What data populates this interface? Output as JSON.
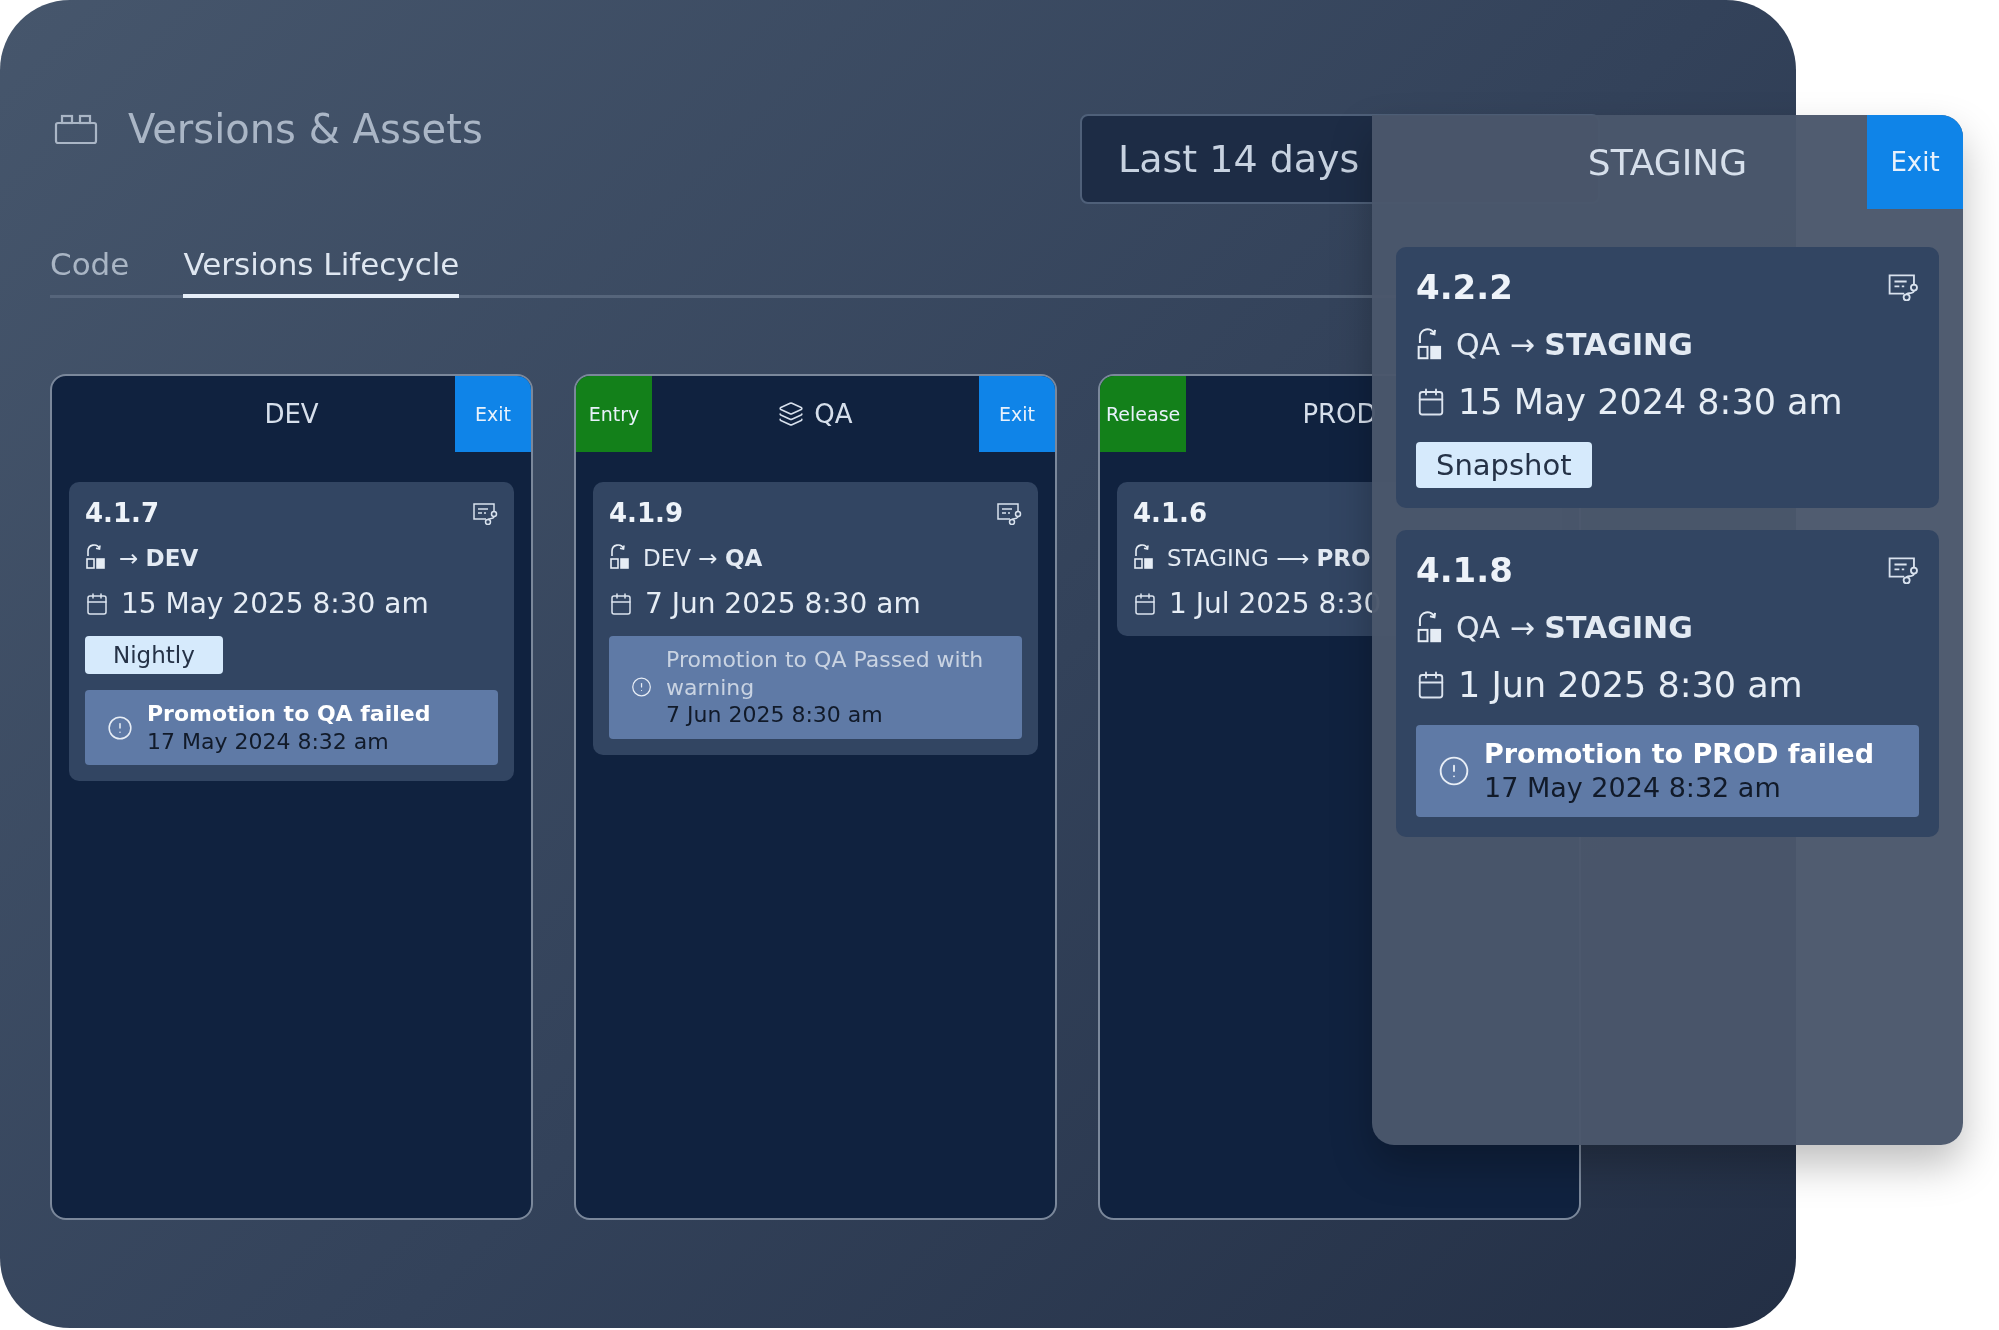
{
  "header": {
    "title": "Versions & Assets"
  },
  "date_range": {
    "value": "Last 14 days"
  },
  "tabs": [
    {
      "label": "Code",
      "selected": false
    },
    {
      "label": "Versions Lifecycle",
      "selected": true
    }
  ],
  "stages": [
    {
      "name": "DEV",
      "icon": false,
      "badges": [
        {
          "label": "Exit",
          "kind": "exit"
        }
      ],
      "versions": [
        {
          "version": "4.1.7",
          "notes": true,
          "arrow": "→",
          "to": "DEV",
          "date": "15 May 2025 8:30 am",
          "tag": "Nightly",
          "alert": {
            "kind": "failed",
            "message": "Promotion to QA failed",
            "time": "17 May 2024 8:32 am"
          }
        }
      ]
    },
    {
      "name": "QA",
      "icon": true,
      "badges": [
        {
          "label": "Entry",
          "kind": "entry"
        },
        {
          "label": "Exit",
          "kind": "exit"
        }
      ],
      "versions": [
        {
          "version": "4.1.9",
          "notes": true,
          "from": "DEV",
          "arrow": "→",
          "to": "QA",
          "date": "7 Jun 2025 8:30 am",
          "alert": {
            "kind": "warning",
            "message": "Promotion to QA Passed with warning",
            "time": "7 Jun 2025 8:30 am"
          }
        }
      ]
    },
    {
      "name": "PROD",
      "icon": false,
      "badges": [
        {
          "label": "Release",
          "kind": "release"
        }
      ],
      "versions": [
        {
          "version": "4.1.6",
          "notes": false,
          "from": "STAGING",
          "arrow": "⟶",
          "to": "PRO",
          "date": "1 Jul 2025 8:30"
        }
      ]
    }
  ],
  "overlay": {
    "name": "STAGING",
    "badges": [
      {
        "label": "Exit",
        "kind": "exit"
      }
    ],
    "versions": [
      {
        "version": "4.2.2",
        "notes": true,
        "from": "QA",
        "arrow": "→",
        "to": "STAGING",
        "date": "15 May 2024 8:30 am",
        "tag": "Snapshot"
      },
      {
        "version": "4.1.8",
        "notes": true,
        "from": "QA",
        "arrow": "→",
        "to": "STAGING",
        "date": "1 Jun 2025 8:30 am",
        "alert": {
          "kind": "failed",
          "message": "Promotion to PROD failed",
          "time": "17 May 2024 8:32 am"
        }
      }
    ]
  }
}
